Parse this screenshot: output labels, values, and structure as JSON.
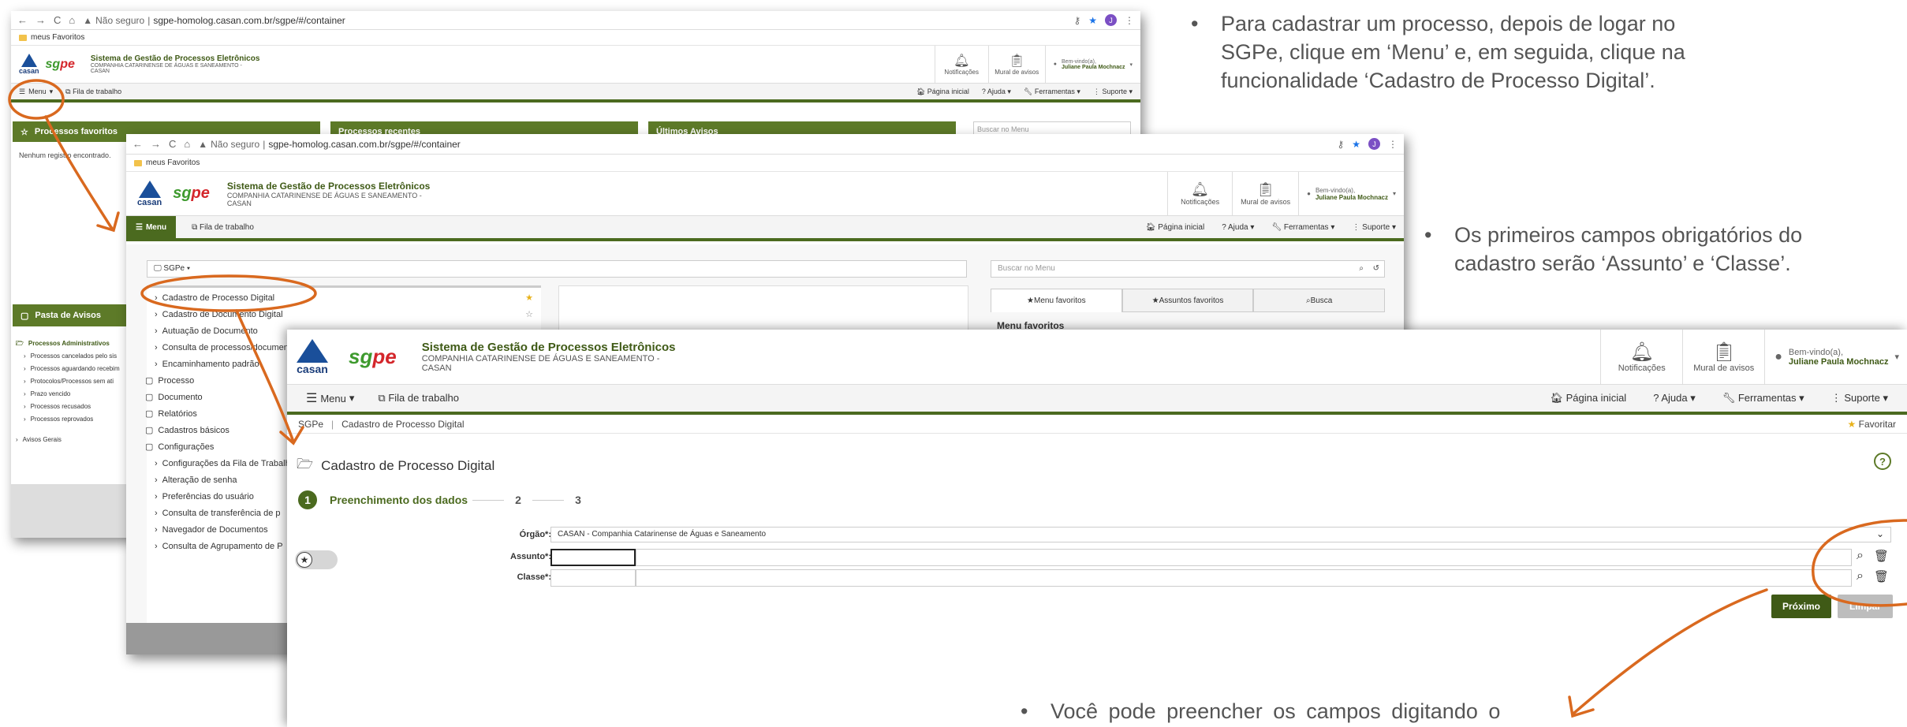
{
  "browser": {
    "security": "Não seguro",
    "url": "sgpe-homolog.casan.com.br/sgpe/#/container",
    "bookmark": "meus Favoritos",
    "profile_initial": "J"
  },
  "app": {
    "org_logo": "casan",
    "brand_logo_1": "sg",
    "brand_logo_2": "pe",
    "system_title": "Sistema de Gestão de Processos Eletrônicos",
    "company_line1": "COMPANHIA CATARINENSE DE ÁGUAS E SANEAMENTO -",
    "company_line2": "CASAN"
  },
  "header": {
    "notifications": "Notificações",
    "board": "Mural de avisos",
    "welcome": "Bem-vindo(a),",
    "user_name": "Juliane Paula Mochnacz"
  },
  "bar": {
    "menu": "Menu",
    "queue": "Fila de trabalho",
    "home": "Página inicial",
    "help": "Ajuda",
    "tools": "Ferramentas",
    "support": "Suporte"
  },
  "shot1": {
    "panel_favorites": "Processos favoritos",
    "no_records": "Nenhum registro encontrado.",
    "panel_recent": "Processos recentes",
    "panel_notices": "Últimos Avisos",
    "search_menu": "Buscar no Menu",
    "notice_board": "Pasta de Avisos",
    "admin_processes": "Processos Administrativos",
    "admin_items": [
      "Processos cancelados pelo sis",
      "Processos aguardando recebim",
      "Protocolos/Processos sem ati",
      "Prazo vencido",
      "Processos recusados",
      "Processos reprovados"
    ],
    "general_notices": "Avisos Gerais"
  },
  "shot2": {
    "sgpe_label": "SGPe",
    "search_menu": "Buscar no Menu",
    "menu_items": [
      "Cadastro de Processo Digital",
      "Cadastro de Documento Digital",
      "Autuação de Documento",
      "Consulta de processos/documentos",
      "Encaminhamento padrão"
    ],
    "folders": [
      "Processo",
      "Documento",
      "Relatórios",
      "Cadastros básicos",
      "Configurações"
    ],
    "sub_items": [
      "Configurações da Fila de Trabalho",
      "Alteração de senha",
      "Preferências do usuário",
      "Consulta de transferência de p",
      "Navegador de Documentos",
      "Consulta de Agrupamento de P"
    ],
    "tabs": [
      "Menu favoritos",
      "Assuntos favoritos",
      "Busca"
    ],
    "fav_heading": "Menu favoritos"
  },
  "shot3": {
    "breadcrumb_root": "SGPe",
    "breadcrumb_page": "Cadastro de Processo Digital",
    "favorite": "Favoritar",
    "page_title": "Cadastro de Processo Digital",
    "steps": [
      {
        "num": "1",
        "label": "Preenchimento dos dados"
      },
      {
        "num": "2",
        "label": ""
      },
      {
        "num": "3",
        "label": ""
      }
    ],
    "org_label": "Órgão*:",
    "org_value": "CASAN - Companhia Catarinense de Águas e Saneamento",
    "subject_label": "Assunto*:",
    "class_label": "Classe*:",
    "next": "Próximo",
    "clear": "Limpar"
  },
  "annotations": {
    "a1": "Para cadastrar um processo, depois de logar no SGPe, clique em ‘Menu’ e, em seguida, clique na funcionalidade ‘Cadastro de Processo Digital’.",
    "a2": "Os primeiros campos obrigatórios do cadastro serão ‘Assunto’ e ‘Classe’.",
    "a3": "Você pode preencher os campos digitando o"
  },
  "colors": {
    "primary_green": "#4b6a1f",
    "panel_green": "#5d7a28",
    "annotation_orange": "#d9691f"
  }
}
